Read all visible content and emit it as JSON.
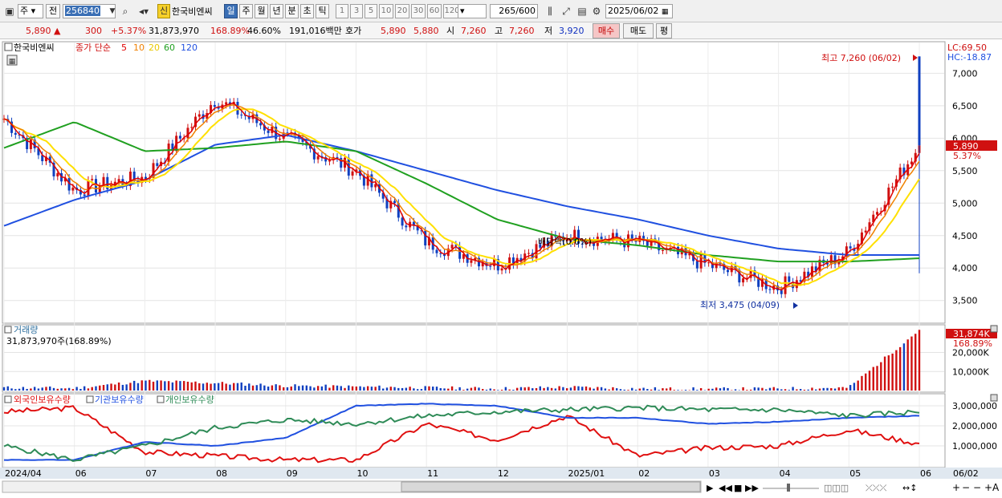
{
  "toolbar": {
    "period_select": "주",
    "prev_label": "전",
    "stock_code": "256840",
    "stock_name": "한국비엔씨",
    "credit_badge": "신",
    "periods": [
      "일",
      "주",
      "월",
      "년",
      "분",
      "초",
      "틱"
    ],
    "active_period": "일",
    "minutes": [
      "1",
      "3",
      "5",
      "10",
      "20",
      "30",
      "60",
      "120"
    ],
    "count_value": "265",
    "count_total": "/600",
    "date_value": "2025/06/02"
  },
  "quote": {
    "price": "5,890",
    "change_arrow": "▲",
    "change": "300",
    "change_rate": "+5.37%",
    "volume": "31,873,970",
    "volume_ratio": "168.89%",
    "turnover_pct": "46.60%",
    "trade_value": "191,016백만",
    "ask_label": "호가",
    "ask": "5,890",
    "bid": "5,880",
    "open_label": "시",
    "open": "7,260",
    "high_label": "고",
    "high": "7,260",
    "low_label": "저",
    "low": "3,920",
    "buy_label": "매수",
    "sell_label": "매도",
    "avg_label": "평"
  },
  "price_panel": {
    "legend_name": "한국비엔씨",
    "legend_ma_prefix": "종가 단순",
    "legend_periods": [
      "5",
      "10",
      "20",
      "60",
      "120"
    ],
    "top_right_lc": "LC:69.50",
    "top_right_hc": "HC:-18.87",
    "max_label": "최고 7,260 (06/02)",
    "min_label": "최저 3,475 (04/09)",
    "dividend_label": "배당락(0.0%)",
    "current_price_tag": "5,890",
    "current_change_tag": "5.37%",
    "y_ticks": [
      "7,000",
      "6,500",
      "6,000",
      "5,500",
      "5,000",
      "4,500",
      "4,000",
      "3,500"
    ]
  },
  "volume_panel": {
    "title": "거래량",
    "value_text": "31,873,970주(168.89%)",
    "tag_value": "31,874K",
    "tag_pct": "168.89%",
    "y_ticks": [
      "20,000K",
      "10,000K"
    ]
  },
  "holding_panel": {
    "legend": [
      "외국인보유수량",
      "기관보유수량",
      "개인보유수량"
    ],
    "y_ticks": [
      "3,000,000",
      "2,000,000",
      "1,000,000"
    ]
  },
  "x_axis": {
    "labels": [
      "2024/04",
      "06",
      "07",
      "08",
      "09",
      "10",
      "11",
      "12",
      "2025/01",
      "02",
      "03",
      "04",
      "05",
      "06"
    ],
    "right_label": "06/02"
  },
  "colors": {
    "up": "#d01010",
    "down": "#1040c0",
    "ma5": "#e00000",
    "ma10": "#f08000",
    "ma20": "#ffe000",
    "ma60": "#20a020",
    "ma120": "#2050e0",
    "foreign": "#e01010",
    "institution": "#2050e0",
    "individual": "#2e8b57"
  },
  "chart_data": [
    {
      "type": "line",
      "title": "",
      "xlabel": "",
      "ylabel": "",
      "ylim": [
        3200,
        7400
      ],
      "x": [
        "2024/04",
        "06",
        "07",
        "08",
        "09",
        "10",
        "11",
        "12",
        "2025/01",
        "02",
        "03",
        "04",
        "05",
        "06"
      ],
      "series": [
        {
          "name": "종가",
          "values": [
            6300,
            5200,
            5400,
            6600,
            6000,
            5500,
            4400,
            4050,
            4500,
            4400,
            4050,
            3700,
            4250,
            5890
          ]
        },
        {
          "name": "120",
          "values": [
            4650,
            5050,
            5350,
            5900,
            6050,
            5800,
            5500,
            5200,
            4950,
            4750,
            4500,
            4300,
            4200,
            4200
          ]
        },
        {
          "name": "60",
          "values": [
            5850,
            6250,
            5800,
            5850,
            5950,
            5800,
            5300,
            4750,
            4450,
            4350,
            4200,
            4100,
            4100,
            4150
          ]
        }
      ]
    },
    {
      "type": "bar",
      "title": "거래량",
      "ylim": [
        0,
        32000
      ],
      "categories": [
        "2024/04",
        "06",
        "07",
        "08",
        "09",
        "10",
        "11",
        "12",
        "2025/01",
        "02",
        "03",
        "04",
        "05",
        "06"
      ],
      "values": [
        1500,
        1200,
        5000,
        4000,
        2500,
        2000,
        1500,
        1000,
        1800,
        1000,
        800,
        1000,
        1500,
        31874
      ]
    },
    {
      "type": "line",
      "title": "",
      "ylim": [
        0,
        3200000
      ],
      "x": [
        "2024/04",
        "06",
        "07",
        "08",
        "09",
        "10",
        "11",
        "12",
        "2025/01",
        "02",
        "03",
        "04",
        "05",
        "06"
      ],
      "series": [
        {
          "name": "외국인보유수량",
          "values": [
            2700000,
            2900000,
            700000,
            500000,
            300000,
            300000,
            2100000,
            1300000,
            2500000,
            500000,
            900000,
            1000000,
            1800000,
            1100000
          ]
        },
        {
          "name": "기관보유수량",
          "values": [
            300000,
            300000,
            1200000,
            1000000,
            1400000,
            3000000,
            3100000,
            3000000,
            2400000,
            2400000,
            2100000,
            2200000,
            2400000,
            2500000
          ]
        },
        {
          "name": "개인보유수량",
          "values": [
            1000000,
            300000,
            1000000,
            1900000,
            2300000,
            2100000,
            2500000,
            2700000,
            2800000,
            2900000,
            2800000,
            2800000,
            2500000,
            2700000
          ]
        }
      ]
    }
  ]
}
